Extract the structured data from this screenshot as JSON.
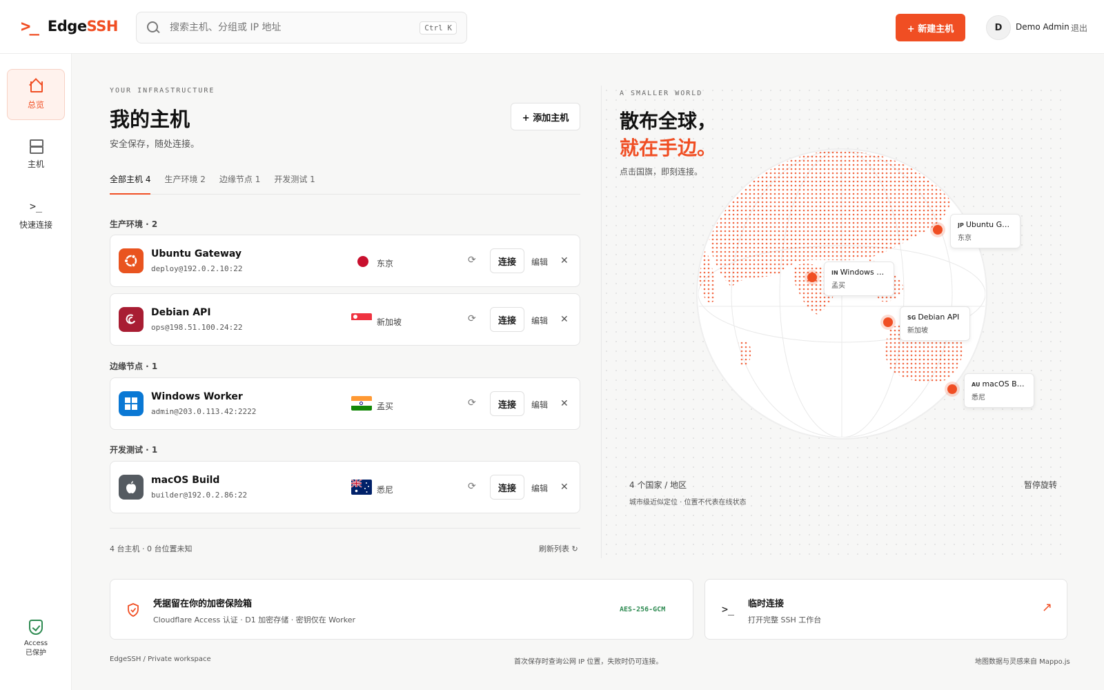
{
  "header": {
    "logo_mark": ">_",
    "logo_text_plain": "Edge",
    "logo_text_accent": "SSH",
    "search_placeholder": "搜索主机、分组或 IP 地址",
    "search_shortcut": "Ctrl K",
    "new_host_label": "+ 新建主机",
    "avatar_initial": "D",
    "user_name": "Demo Admin",
    "logout_label": "退出"
  },
  "sidebar": {
    "items": [
      {
        "label": "总览",
        "icon": "home-icon",
        "active": true
      },
      {
        "label": "主机",
        "icon": "server-icon",
        "active": false
      },
      {
        "label": "快速连接",
        "icon": "terminal-icon",
        "active": false
      }
    ],
    "access_line1": "Access",
    "access_line2": "已保护"
  },
  "main": {
    "eyebrow": "YOUR INFRASTRUCTURE",
    "title": "我的主机",
    "subtitle": "安全保存，随处连接。",
    "add_host_label": "+ 添加主机",
    "tabs": [
      {
        "label": "全部主机 4",
        "active": true
      },
      {
        "label": "生产环境 2",
        "active": false
      },
      {
        "label": "边缘节点 1",
        "active": false
      },
      {
        "label": "开发测试 1",
        "active": false
      }
    ],
    "groups": [
      {
        "label": "生产环境 · 2"
      },
      {
        "label": "边缘节点 · 1"
      },
      {
        "label": "开发测试 · 1"
      }
    ],
    "hosts": [
      {
        "name": "Ubuntu Gateway",
        "address": "deploy@192.0.2.10:22",
        "city": "东京",
        "os_icon": "ubuntu-icon",
        "flag": "japan-flag"
      },
      {
        "name": "Debian API",
        "address": "ops@198.51.100.24:22",
        "city": "新加坡",
        "os_icon": "debian-icon",
        "flag": "singapore-flag"
      },
      {
        "name": "Windows Worker",
        "address": "admin@203.0.113.42:2222",
        "city": "孟买",
        "os_icon": "windows-icon",
        "flag": "india-flag"
      },
      {
        "name": "macOS Build",
        "address": "builder@192.0.2.86:22",
        "city": "悉尼",
        "os_icon": "apple-icon",
        "flag": "australia-flag"
      }
    ],
    "connect_label": "连接",
    "edit_label": "编辑",
    "refresh_glyph": "⟳",
    "close_glyph": "✕",
    "footer_count": "4 台主机 · 0 台位置未知",
    "refresh_list_label": "刷新列表 ↻"
  },
  "globe": {
    "eyebrow": "A SMALLER WORLD",
    "title_line1": "散布全球，",
    "title_line2": "就在手边。",
    "hint": "点击国旗，即刻连接。",
    "tags": [
      {
        "code": "JP",
        "name": "Ubuntu Gat...",
        "city": "东京"
      },
      {
        "code": "IN",
        "name": "Windows W...",
        "city": "孟买"
      },
      {
        "code": "SG",
        "name": "Debian API",
        "city": "新加坡"
      },
      {
        "code": "AU",
        "name": "macOS Build",
        "city": "悉尼"
      }
    ],
    "countries": "4 个国家 / 地区",
    "pause_label": "暂停旋转",
    "approx_note": "城市级近似定位 · 位置不代表在线状态",
    "accent_color": "#f04e23"
  },
  "cards": {
    "vault_title": "凭据留在你的加密保险箱",
    "vault_sub": "Cloudflare Access 认证 · D1 加密存储 · 密钥仅在 Worker",
    "vault_tag": "AES-256-GCM",
    "temp_title": "临时连接",
    "temp_sub": "打开完整 SSH 工作台",
    "temp_arrow": "↗"
  },
  "footer": {
    "left": "EdgeSSH / Private workspace",
    "center": "首次保存时查询公网 IP 位置，失败时仍可连接。",
    "right": "地图数据与灵感来自 Mappo.js"
  }
}
